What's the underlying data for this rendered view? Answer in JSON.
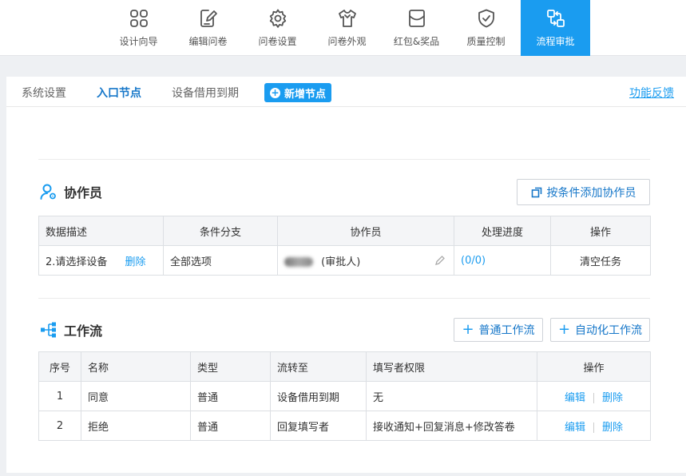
{
  "toolbar": {
    "items": [
      {
        "label": "设计向导",
        "icon": "grid-four-icon"
      },
      {
        "label": "编辑问卷",
        "icon": "edit-doc-icon"
      },
      {
        "label": "问卷设置",
        "icon": "gear-icon"
      },
      {
        "label": "问卷外观",
        "icon": "shirt-icon"
      },
      {
        "label": "红包&奖品",
        "icon": "envelope-icon"
      },
      {
        "label": "质量控制",
        "icon": "shield-check-icon"
      },
      {
        "label": "流程审批",
        "icon": "flow-icon",
        "active": true
      }
    ]
  },
  "subtabs": {
    "items": [
      "系统设置",
      "入口节点",
      "设备借用到期"
    ],
    "active": "入口节点",
    "add_node": "新增节点",
    "feedback": "功能反馈"
  },
  "collaborators": {
    "title": "协作员",
    "add_button": "按条件添加协作员",
    "columns": [
      "数据描述",
      "条件分支",
      "协作员",
      "处理进度",
      "操作"
    ],
    "rows": [
      {
        "desc": "2.请选择设备",
        "delete": "删除",
        "branch": "全部选项",
        "collaborator_role": "(审批人)",
        "progress": "(0/0)",
        "action": "清空任务"
      }
    ]
  },
  "workflow": {
    "title": "工作流",
    "normal_button": "普通工作流",
    "auto_button": "自动化工作流",
    "columns": [
      "序号",
      "名称",
      "类型",
      "流转至",
      "填写者权限",
      "操作"
    ],
    "rows": [
      {
        "no": "1",
        "name": "同意",
        "type": "普通",
        "to": "设备借用到期",
        "perm": "无",
        "edit": "编辑",
        "delete": "删除"
      },
      {
        "no": "2",
        "name": "拒绝",
        "type": "普通",
        "to": "回复填写者",
        "perm": "接收通知+回复消息+修改答卷",
        "edit": "编辑",
        "delete": "删除"
      }
    ]
  },
  "colors": {
    "accent": "#1a9cf0",
    "link_dark": "#1677c9"
  }
}
